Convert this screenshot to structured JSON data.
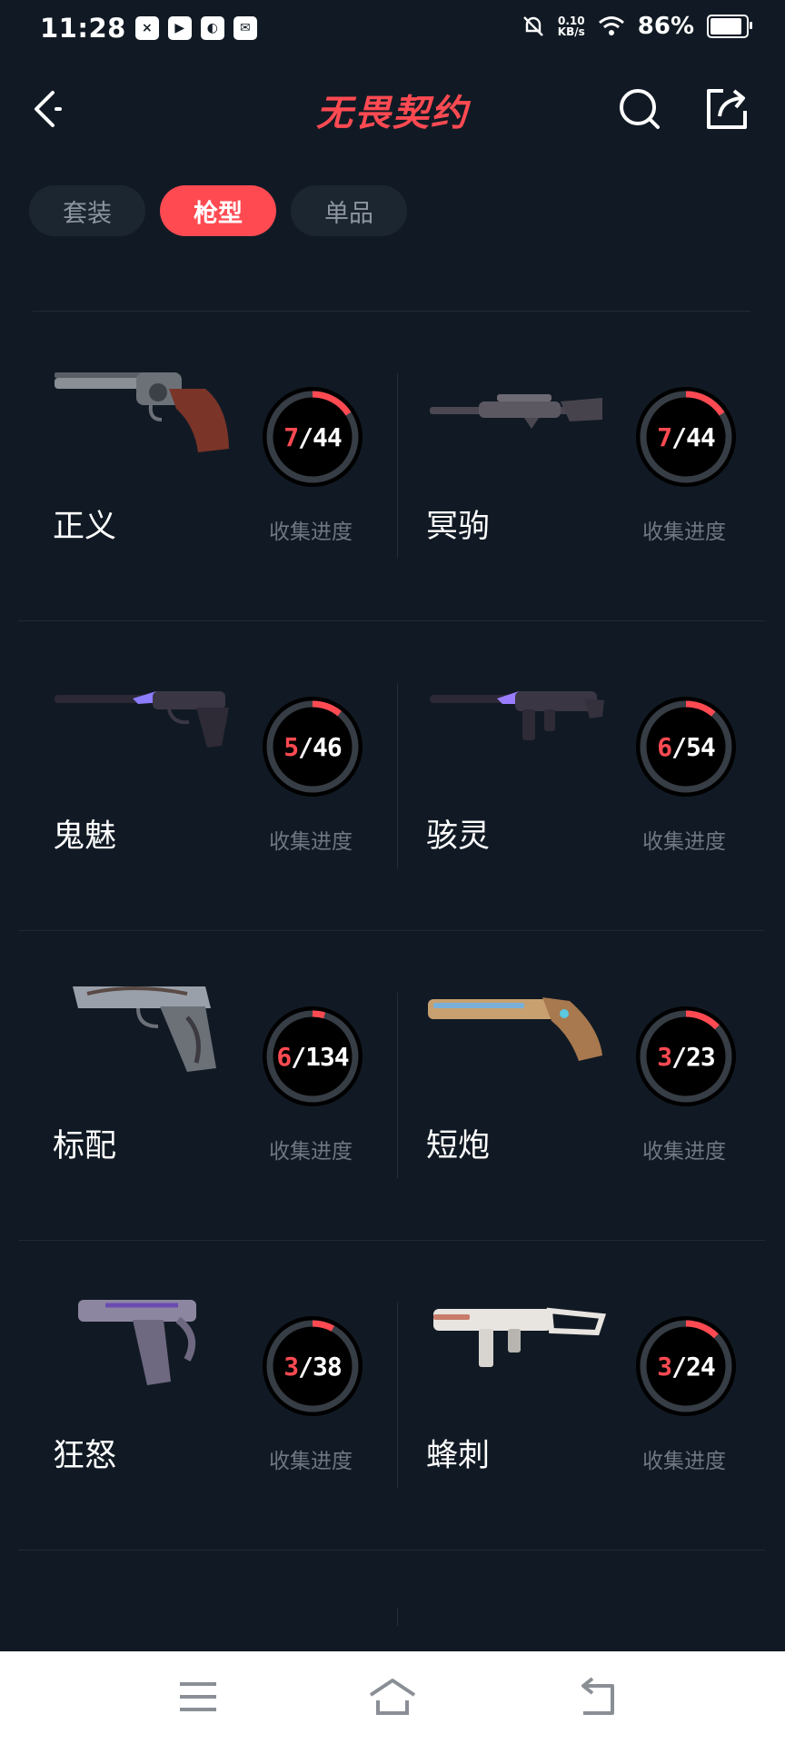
{
  "status_bar": {
    "time": "11:28",
    "net_speed_value": "0.10",
    "net_speed_unit": "KB/s",
    "battery": "86%"
  },
  "header": {
    "title": "无畏契约"
  },
  "tabs": [
    {
      "label": "套装",
      "active": false
    },
    {
      "label": "枪型",
      "active": true
    },
    {
      "label": "单品",
      "active": false
    }
  ],
  "progress_label": "收集进度",
  "weapons": [
    {
      "name": "正义",
      "collected": "7",
      "total": "44",
      "progress": 0.159,
      "icon": "revolver-icon"
    },
    {
      "name": "冥驹",
      "collected": "7",
      "total": "44",
      "progress": 0.159,
      "icon": "sniper-rifle-icon"
    },
    {
      "name": "鬼魅",
      "collected": "5",
      "total": "46",
      "progress": 0.109,
      "icon": "ghost-pistol-icon"
    },
    {
      "name": "骇灵",
      "collected": "6",
      "total": "54",
      "progress": 0.111,
      "icon": "spectre-smg-icon"
    },
    {
      "name": "标配",
      "collected": "6",
      "total": "134",
      "progress": 0.045,
      "icon": "classic-pistol-icon"
    },
    {
      "name": "短炮",
      "collected": "3",
      "total": "23",
      "progress": 0.13,
      "icon": "shorty-shotgun-icon"
    },
    {
      "name": "狂怒",
      "collected": "3",
      "total": "38",
      "progress": 0.079,
      "icon": "frenzy-pistol-icon"
    },
    {
      "name": "蜂刺",
      "collected": "3",
      "total": "24",
      "progress": 0.125,
      "icon": "stinger-smg-icon"
    }
  ],
  "colors": {
    "background": "#111a24",
    "accent": "#ff4a52",
    "gauge_track": "#363d45",
    "muted_text": "#6e7782"
  }
}
